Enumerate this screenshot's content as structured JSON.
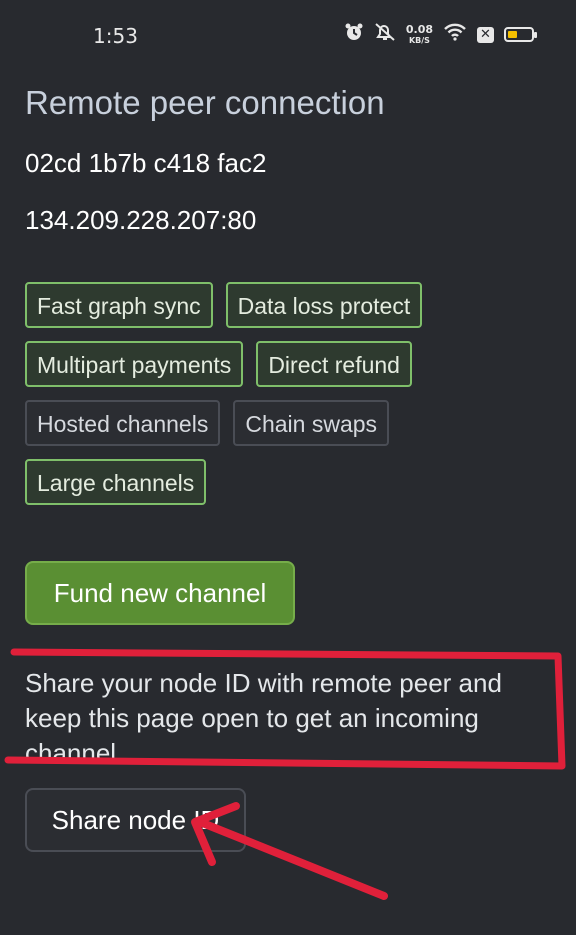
{
  "status_bar": {
    "time": "1:53",
    "net_speed_value": "0.08",
    "net_speed_unit": "KB/S",
    "icons": [
      "alarm-icon",
      "mute-icon",
      "wifi-icon",
      "close-box-icon",
      "battery-icon"
    ],
    "battery_level": 0.35,
    "battery_color": "#f5c000"
  },
  "page": {
    "title": "Remote peer connection",
    "node_id": "02cd 1b7b c418 fac2",
    "address": "134.209.228.207:80"
  },
  "features": [
    {
      "label": "Fast graph sync",
      "enabled": true
    },
    {
      "label": "Data loss protect",
      "enabled": true
    },
    {
      "label": "Multipart payments",
      "enabled": true
    },
    {
      "label": "Direct refund",
      "enabled": true
    },
    {
      "label": "Hosted channels",
      "enabled": false
    },
    {
      "label": "Chain swaps",
      "enabled": false
    },
    {
      "label": "Large channels",
      "enabled": true
    }
  ],
  "actions": {
    "fund_label": "Fund new channel",
    "share_hint": "Share your node ID with remote peer and keep this page open to get an incoming channel",
    "share_label": "Share node ID"
  },
  "colors": {
    "background": "#282a2f",
    "accent_green": "#5a8f33",
    "chip_enabled_border": "#7fbf6a",
    "annotation_red": "#e0203a"
  }
}
